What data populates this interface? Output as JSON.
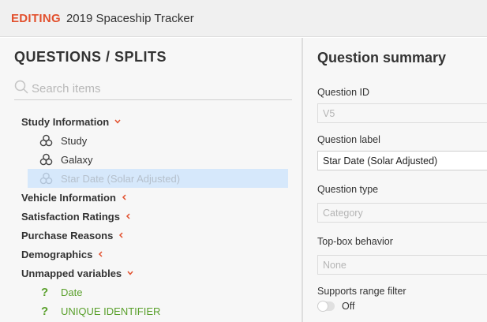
{
  "header": {
    "mode": "EDITING",
    "title": "2019 Spaceship Tracker"
  },
  "left_panel": {
    "title": "QUESTIONS / SPLITS",
    "search_placeholder": "Search items",
    "groups": [
      {
        "label": "Study Information",
        "caret": "⌄",
        "expanded": true
      },
      {
        "label": "Vehicle Information",
        "caret": "‹",
        "expanded": false
      },
      {
        "label": "Satisfaction Ratings",
        "caret": "‹",
        "expanded": false
      },
      {
        "label": "Purchase Reasons",
        "caret": "‹",
        "expanded": false
      },
      {
        "label": "Demographics",
        "caret": "‹",
        "expanded": false
      },
      {
        "label": "Unmapped variables",
        "caret": "⌄",
        "expanded": true
      }
    ],
    "study_items": [
      "Study",
      "Galaxy",
      "Star Date (Solar Adjusted)"
    ],
    "unmapped_items": [
      "Date",
      "UNIQUE IDENTIFIER"
    ],
    "unmapped_icon": "?"
  },
  "right_panel": {
    "title": "Question summary",
    "question_id_label": "Question ID",
    "question_id_value": "V5",
    "question_label_label": "Question label",
    "question_label_value": "Star Date (Solar Adjusted)",
    "question_type_label": "Question type",
    "question_type_value": "Category",
    "topbox_label": "Top-box behavior",
    "topbox_value": "None",
    "range_filter_label": "Supports range filter",
    "range_filter_value": "Off"
  },
  "colors": {
    "accent": "#e2502d",
    "selected_bg": "#d6e8fb",
    "unmapped_green": "#5aa02c"
  },
  "icons": {
    "search": "search-icon",
    "item": "circles-icon",
    "unmapped": "question-mark-icon"
  }
}
